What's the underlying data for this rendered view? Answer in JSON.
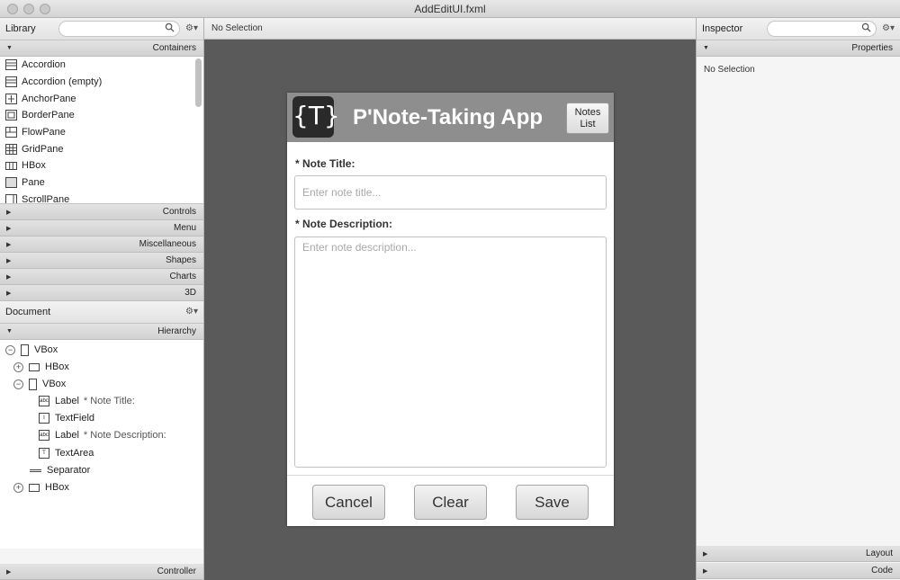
{
  "window": {
    "title": "AddEditUI.fxml"
  },
  "library": {
    "title": "Library",
    "search_placeholder": "",
    "sections_top": [
      "Containers"
    ],
    "containers": [
      {
        "label": "Accordion",
        "icon": "accordion-icon"
      },
      {
        "label": "Accordion  (empty)",
        "icon": "accordion-icon"
      },
      {
        "label": "AnchorPane",
        "icon": "anchorpane-icon"
      },
      {
        "label": "BorderPane",
        "icon": "borderpane-icon"
      },
      {
        "label": "FlowPane",
        "icon": "flowpane-icon"
      },
      {
        "label": "GridPane",
        "icon": "gridpane-icon"
      },
      {
        "label": "HBox",
        "icon": "hbox-icon"
      },
      {
        "label": "Pane",
        "icon": "pane-icon"
      },
      {
        "label": "ScrollPane",
        "icon": "scrollpane-icon"
      }
    ],
    "sections": [
      "Controls",
      "Menu",
      "Miscellaneous",
      "Shapes",
      "Charts",
      "3D"
    ]
  },
  "document": {
    "title": "Document",
    "hierarchy_label": "Hierarchy",
    "controller_label": "Controller",
    "tree": [
      {
        "label": "VBox",
        "sub": "",
        "toggle": "−",
        "icon": "vbox-icon"
      },
      {
        "label": "HBox",
        "sub": "",
        "toggle": "+",
        "icon": "hbox-icon"
      },
      {
        "label": "VBox",
        "sub": "",
        "toggle": "−",
        "icon": "vbox-icon"
      },
      {
        "label": "Label",
        "sub": "* Note Title:",
        "toggle": "",
        "icon": "label-icon"
      },
      {
        "label": "TextField",
        "sub": "",
        "toggle": "",
        "icon": "textfield-icon"
      },
      {
        "label": "Label",
        "sub": "* Note Description:",
        "toggle": "",
        "icon": "label-icon"
      },
      {
        "label": "TextArea",
        "sub": "",
        "toggle": "",
        "icon": "textarea-icon"
      },
      {
        "label": "Separator",
        "sub": "",
        "toggle": "",
        "icon": "separator-icon"
      },
      {
        "label": "HBox",
        "sub": "",
        "toggle": "+",
        "icon": "hbox-icon"
      }
    ]
  },
  "canvas": {
    "header": "No Selection",
    "app": {
      "logo_text": "{T}",
      "title": "P'Note-Taking App",
      "notes_button_line1": "Notes",
      "notes_button_line2": "List",
      "title_label": "* Note Title:",
      "title_placeholder": "Enter note title...",
      "desc_label": "* Note Description:",
      "desc_placeholder": "Enter note description...",
      "cancel": "Cancel",
      "clear": "Clear",
      "save": "Save"
    }
  },
  "inspector": {
    "title": "Inspector",
    "properties": "Properties",
    "no_selection": "No Selection",
    "layout": "Layout",
    "code": "Code"
  }
}
